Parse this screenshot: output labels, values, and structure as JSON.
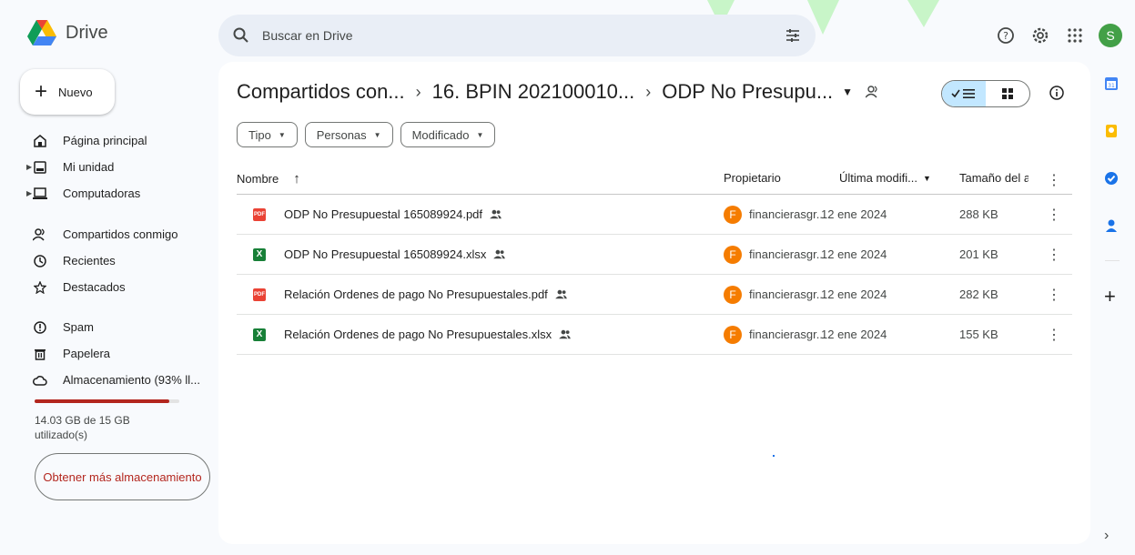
{
  "app": {
    "name": "Drive"
  },
  "search": {
    "placeholder": "Buscar en Drive"
  },
  "top": {
    "avatar_letter": "S"
  },
  "new_button": {
    "label": "Nuevo"
  },
  "sidebar": {
    "items": [
      {
        "label": "Página principal",
        "icon": "home-icon"
      },
      {
        "label": "Mi unidad",
        "icon": "drive-icon"
      },
      {
        "label": "Computadoras",
        "icon": "computer-icon"
      },
      {
        "label": "Compartidos conmigo",
        "icon": "shared-icon"
      },
      {
        "label": "Recientes",
        "icon": "clock-icon"
      },
      {
        "label": "Destacados",
        "icon": "star-icon"
      },
      {
        "label": "Spam",
        "icon": "spam-icon"
      },
      {
        "label": "Papelera",
        "icon": "trash-icon"
      },
      {
        "label": "Almacenamiento (93% ll...",
        "icon": "cloud-icon"
      }
    ],
    "storage": {
      "used_fraction": 0.93,
      "text": "14.03 GB de 15 GB utilizado(s)",
      "button": "Obtener más almacenamiento",
      "bar_color": "#b3261e"
    }
  },
  "breadcrumb": [
    "Compartidos con...",
    "16. BPIN 202100010...",
    "ODP No Presupu..."
  ],
  "filters": [
    "Tipo",
    "Personas",
    "Modificado"
  ],
  "table": {
    "headers": {
      "name": "Nombre",
      "owner": "Propietario",
      "modified": "Última modifi...",
      "size": "Tamaño del a"
    },
    "rows": [
      {
        "name": "ODP No Presupuestal 165089924.pdf",
        "type": "pdf",
        "owner_initial": "F",
        "owner": "financierasgr...",
        "modified": "12 ene 2024",
        "size": "288 KB"
      },
      {
        "name": "ODP No Presupuestal 165089924.xlsx",
        "type": "xlsx",
        "owner_initial": "F",
        "owner": "financierasgr...",
        "modified": "12 ene 2024",
        "size": "201 KB"
      },
      {
        "name": "Relación Ordenes de pago No Presupuestales.pdf",
        "type": "pdf",
        "owner_initial": "F",
        "owner": "financierasgr...",
        "modified": "12 ene 2024",
        "size": "282 KB"
      },
      {
        "name": "Relación Ordenes de pago No Presupuestales.xlsx",
        "type": "xlsx",
        "owner_initial": "F",
        "owner": "financierasgr...",
        "modified": "12 ene 2024",
        "size": "155 KB"
      }
    ]
  },
  "file_icon_text": {
    "pdf": "PDF",
    "xlsx": "X"
  }
}
